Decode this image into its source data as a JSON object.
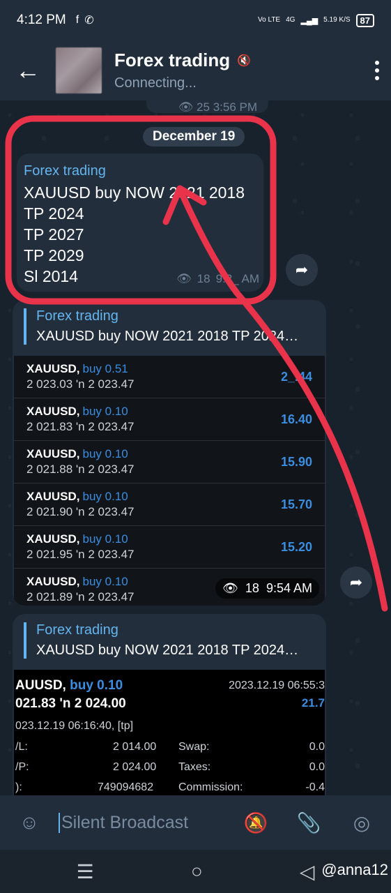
{
  "status": {
    "time": "4:12 PM",
    "net": "Vo LTE",
    "gen": "4G",
    "speed": "5.19 K/S",
    "battery": "87"
  },
  "header": {
    "title": "Forex trading",
    "subtitle": "Connecting..."
  },
  "prev": {
    "views": "25",
    "time": "3:56 PM"
  },
  "date": "December 19",
  "msg1": {
    "sender": "Forex trading",
    "text": "XAUUSD buy NOW 2021 2018\nTP 2024\nTP 2027\nTP 2029\nSl 2014",
    "views": "18",
    "time": "9:2_ AM"
  },
  "msg2": {
    "reply_sender": "Forex trading",
    "reply_text": "XAUUSD buy NOW 2021 2018 TP 2024…",
    "trades": [
      {
        "symbol": "XAUUSD,",
        "dir": "buy 0.51",
        "prices": "2 023.03 'n 2 023.47",
        "pnl": "2_.44"
      },
      {
        "symbol": "XAUUSD,",
        "dir": "buy 0.10",
        "prices": "2 021.83 'n 2 023.47",
        "pnl": "16.40"
      },
      {
        "symbol": "XAUUSD,",
        "dir": "buy 0.10",
        "prices": "2 021.88 'n 2 023.47",
        "pnl": "15.90"
      },
      {
        "symbol": "XAUUSD,",
        "dir": "buy 0.10",
        "prices": "2 021.90 'n 2 023.47",
        "pnl": "15.70"
      },
      {
        "symbol": "XAUUSD,",
        "dir": "buy 0.10",
        "prices": "2 021.95 'n 2 023.47",
        "pnl": "15.20"
      },
      {
        "symbol": "XAUUSD,",
        "dir": "buy 0.10",
        "prices": "2 021.89 'n 2 023.47",
        "pnl": ""
      }
    ],
    "views": "18",
    "time": "9:54 AM"
  },
  "msg3": {
    "reply_sender": "Forex trading",
    "reply_text": "XAUUSD buy NOW 2021 2018 TP 2024…",
    "symbol": "AUUSD,",
    "dir": "buy 0.10",
    "prices": "021.83 'n 2 024.00",
    "close_time": "2023.12.19 06:55:3",
    "profit": "21.7",
    "open_time": "023.12.19 06:16:40, [tp]",
    "rows": [
      {
        "k1": "/L:",
        "v1": "2 014.00",
        "k2": "Swap:",
        "v2": "0.0"
      },
      {
        "k1": "/P:",
        "v1": "2 024.00",
        "k2": "Taxes:",
        "v2": "0.0"
      },
      {
        "k1": "):",
        "v1": "749094682",
        "k2": "Commission:",
        "v2": "-0.4"
      }
    ]
  },
  "input": {
    "placeholder": "Silent Broadcast"
  },
  "watermark": "@anna12",
  "colors": {
    "annotation": "#e8334a",
    "accent": "#64b5ef",
    "profit": "#3b8de0"
  }
}
